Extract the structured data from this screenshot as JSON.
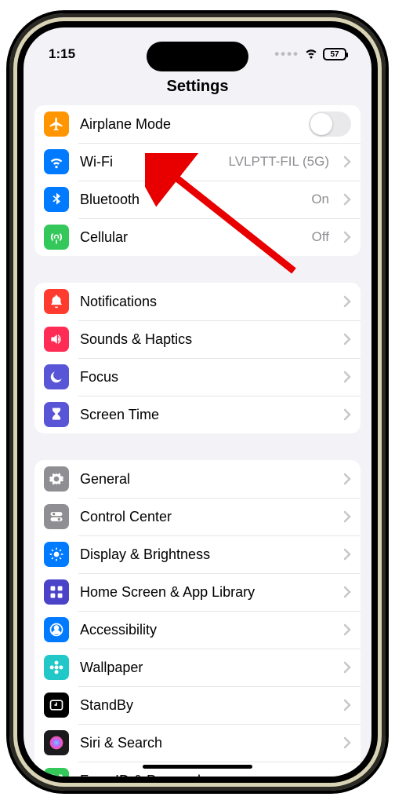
{
  "status": {
    "time": "1:15",
    "battery": "57"
  },
  "header": {
    "title": "Settings"
  },
  "groups": [
    {
      "rows": [
        {
          "id": "airplane",
          "label": "Airplane Mode",
          "icon": "airplane",
          "iconBg": "#ff9500",
          "control": "toggle",
          "toggle": false
        },
        {
          "id": "wifi",
          "label": "Wi-Fi",
          "icon": "wifi",
          "iconBg": "#007aff",
          "value": "LVLPTT-FIL (5G)",
          "control": "chevron"
        },
        {
          "id": "bluetooth",
          "label": "Bluetooth",
          "icon": "bluetooth",
          "iconBg": "#007aff",
          "value": "On",
          "control": "chevron"
        },
        {
          "id": "cellular",
          "label": "Cellular",
          "icon": "antenna",
          "iconBg": "#34c759",
          "value": "Off",
          "control": "chevron"
        }
      ]
    },
    {
      "rows": [
        {
          "id": "notifications",
          "label": "Notifications",
          "icon": "bell",
          "iconBg": "#ff3b30",
          "control": "chevron"
        },
        {
          "id": "sounds",
          "label": "Sounds & Haptics",
          "icon": "speaker",
          "iconBg": "#ff2d55",
          "control": "chevron"
        },
        {
          "id": "focus",
          "label": "Focus",
          "icon": "moon",
          "iconBg": "#5856d6",
          "control": "chevron"
        },
        {
          "id": "screentime",
          "label": "Screen Time",
          "icon": "hourglass",
          "iconBg": "#5856d6",
          "control": "chevron"
        }
      ]
    },
    {
      "rows": [
        {
          "id": "general",
          "label": "General",
          "icon": "gear",
          "iconBg": "#8e8e93",
          "control": "chevron"
        },
        {
          "id": "controlcenter",
          "label": "Control Center",
          "icon": "toggles",
          "iconBg": "#8e8e93",
          "control": "chevron"
        },
        {
          "id": "display",
          "label": "Display & Brightness",
          "icon": "sun",
          "iconBg": "#007aff",
          "control": "chevron"
        },
        {
          "id": "homescreen",
          "label": "Home Screen & App Library",
          "icon": "grid",
          "iconBg": "#4a42c9",
          "control": "chevron"
        },
        {
          "id": "accessibility",
          "label": "Accessibility",
          "icon": "person",
          "iconBg": "#007aff",
          "control": "chevron"
        },
        {
          "id": "wallpaper",
          "label": "Wallpaper",
          "icon": "flower",
          "iconBg": "#22c8c8",
          "control": "chevron"
        },
        {
          "id": "standby",
          "label": "StandBy",
          "icon": "clock",
          "iconBg": "#000000",
          "control": "chevron"
        },
        {
          "id": "siri",
          "label": "Siri & Search",
          "icon": "siri",
          "iconBg": "#1b1b1d",
          "control": "chevron"
        },
        {
          "id": "faceid",
          "label": "Face ID & Passcode",
          "icon": "faceid",
          "iconBg": "#34c759",
          "control": "chevron"
        }
      ]
    }
  ],
  "annotation": {
    "arrowTarget": "wifi"
  }
}
